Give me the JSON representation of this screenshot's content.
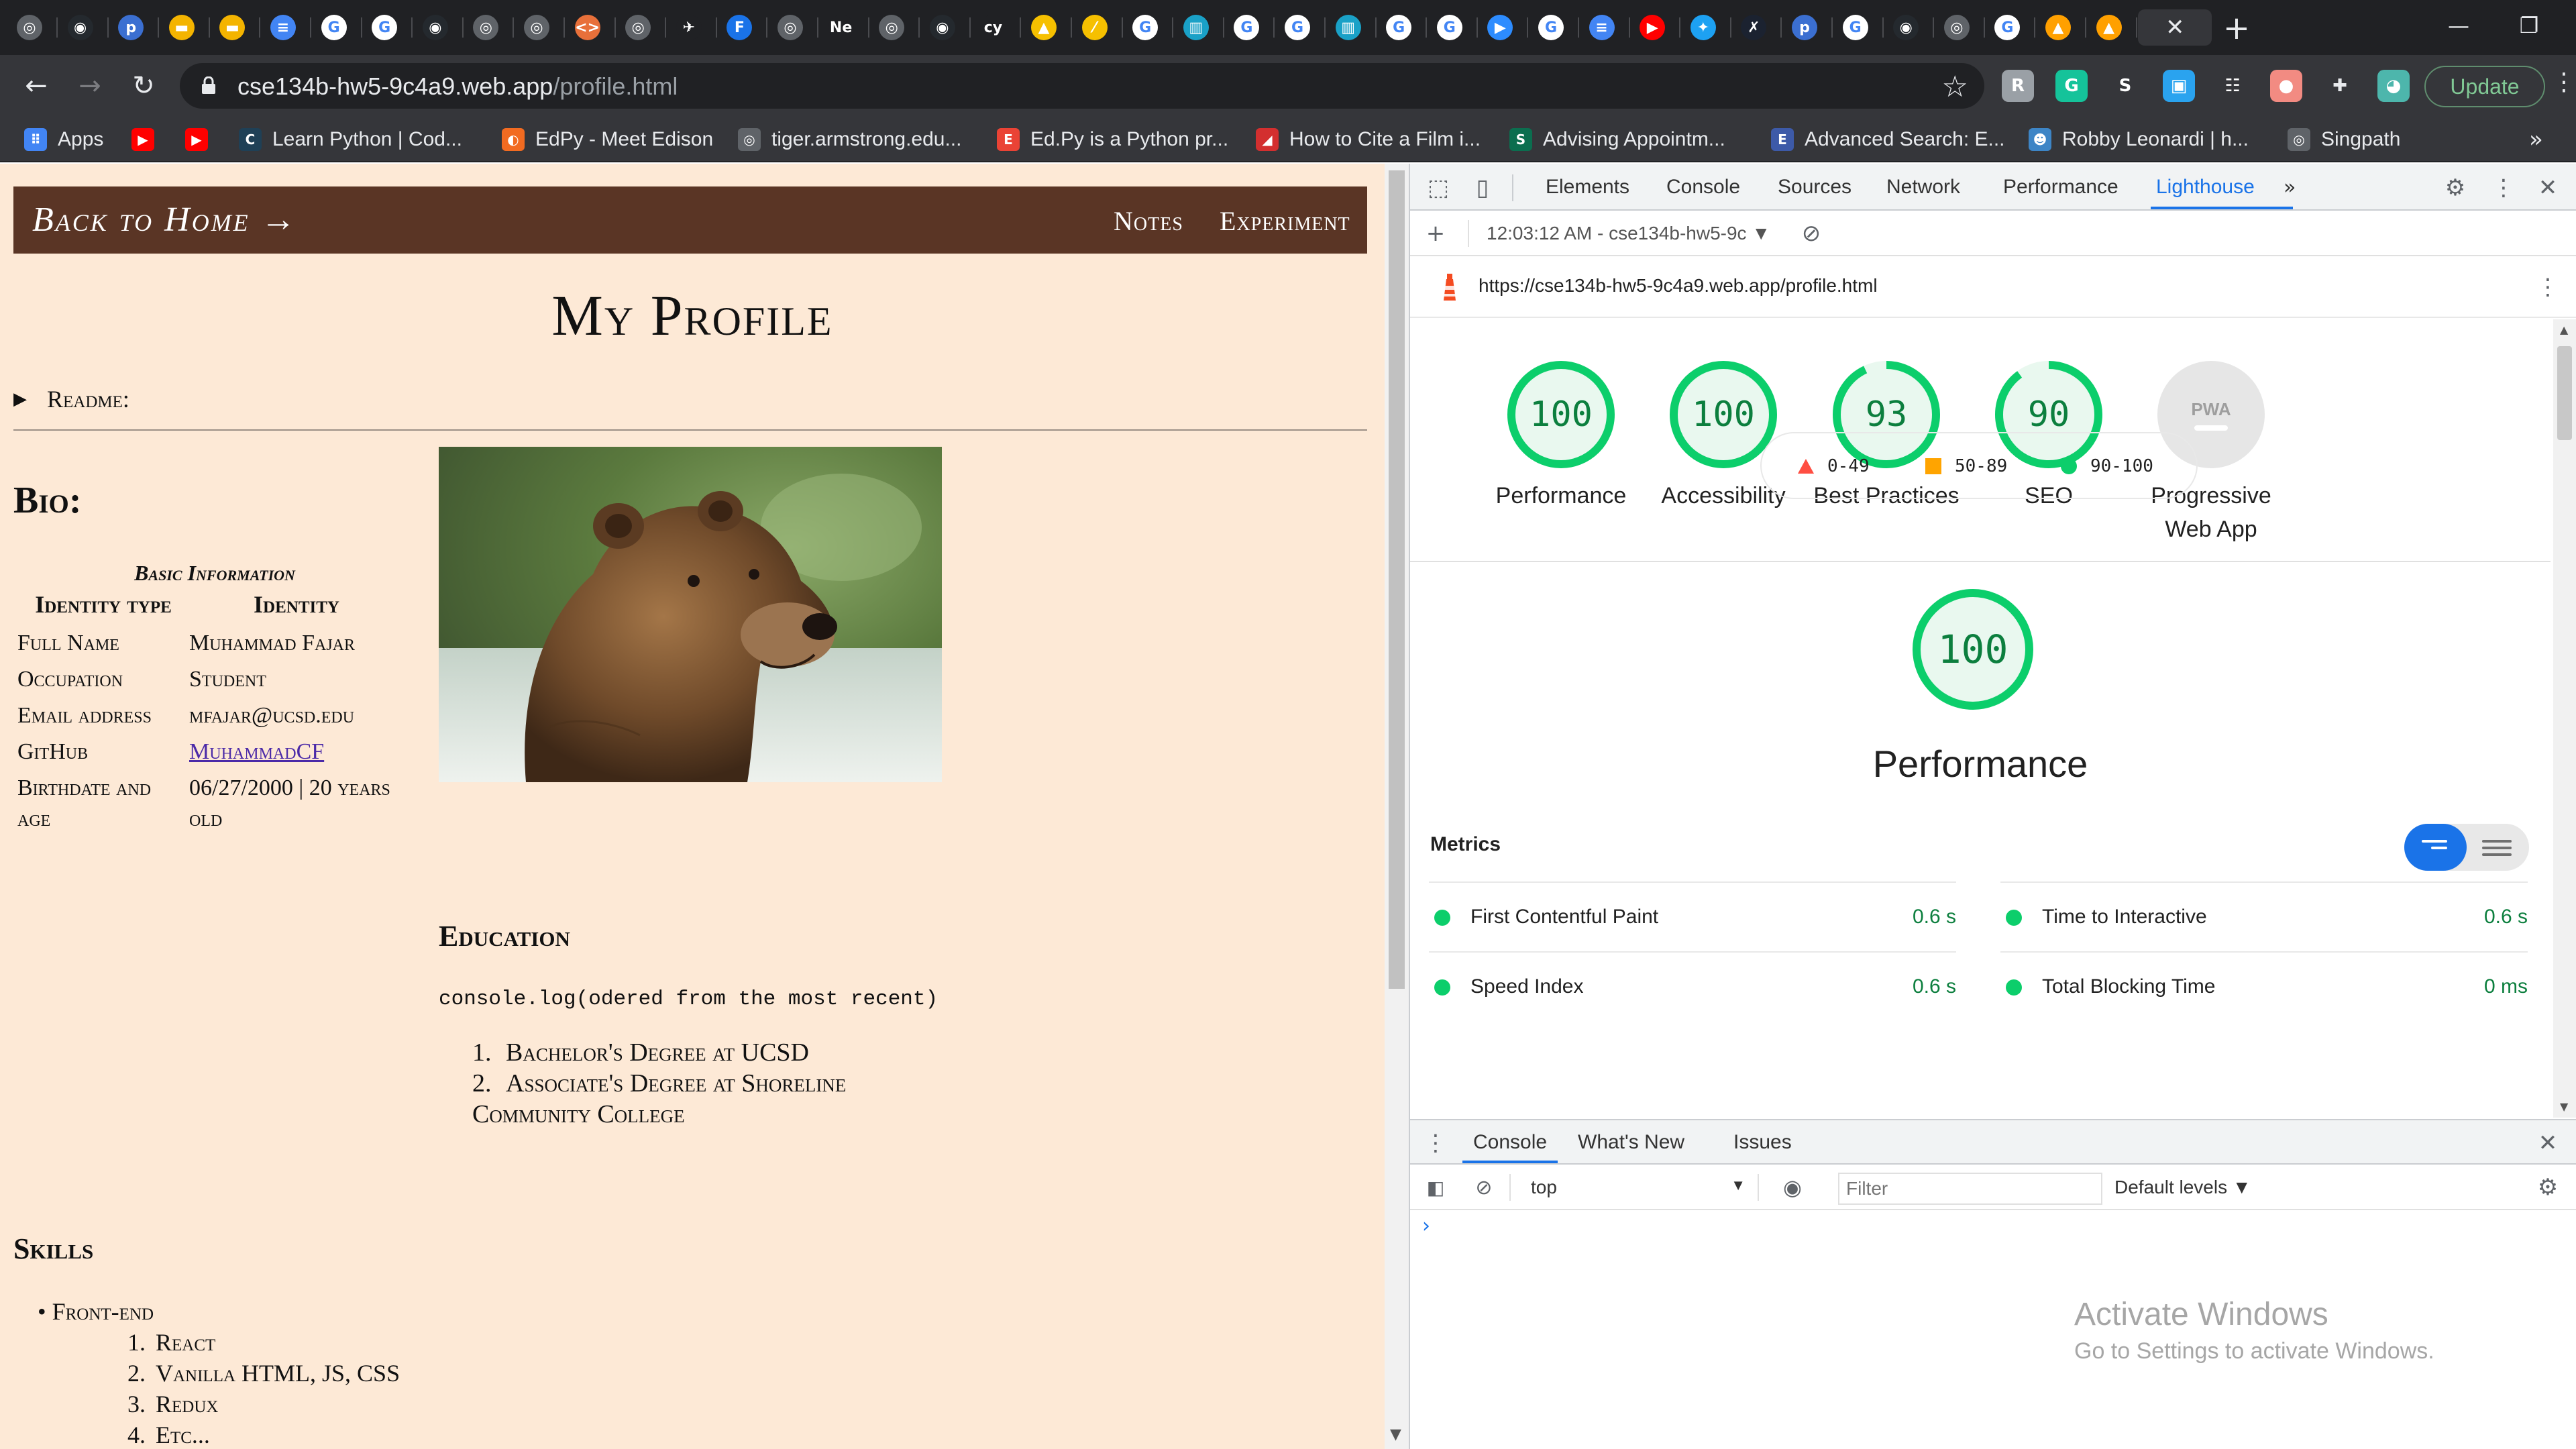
{
  "browser": {
    "tab_favicons": [
      {
        "name": "chrome-globe-icon",
        "color": "#5f6368",
        "glyph": "◎"
      },
      {
        "name": "github-icon",
        "color": "#24292e",
        "glyph": "◉"
      },
      {
        "name": "p-icon",
        "color": "#3b6fd1",
        "glyph": "p"
      },
      {
        "name": "slides-icon",
        "color": "#f4b400",
        "glyph": "▬"
      },
      {
        "name": "slides-icon",
        "color": "#f4b400",
        "glyph": "▬"
      },
      {
        "name": "docs-icon",
        "color": "#4285f4",
        "glyph": "≡"
      },
      {
        "name": "google-icon",
        "color": "#ffffff",
        "glyph": "G"
      },
      {
        "name": "google-icon",
        "color": "#ffffff",
        "glyph": "G"
      },
      {
        "name": "github-icon",
        "color": "#24292e",
        "glyph": "◉"
      },
      {
        "name": "chrome-globe-icon",
        "color": "#5f6368",
        "glyph": "◎"
      },
      {
        "name": "chrome-globe-icon",
        "color": "#5f6368",
        "glyph": "◎"
      },
      {
        "name": "code-icon",
        "color": "#e8703a",
        "glyph": "<>"
      },
      {
        "name": "chrome-globe-icon",
        "color": "#5f6368",
        "glyph": "◎"
      },
      {
        "name": "plane-icon",
        "color": "#202124",
        "glyph": "✈"
      },
      {
        "name": "f-icon",
        "color": "#1a73e8",
        "glyph": "F"
      },
      {
        "name": "chrome-globe-icon",
        "color": "#5f6368",
        "glyph": "◎"
      },
      {
        "name": "ne-icon",
        "color": "#202124",
        "glyph": "Ne"
      },
      {
        "name": "chrome-globe-icon",
        "color": "#5f6368",
        "glyph": "◎"
      },
      {
        "name": "github-icon",
        "color": "#24292e",
        "glyph": "◉"
      },
      {
        "name": "cy-icon",
        "color": "#202124",
        "glyph": "cy"
      },
      {
        "name": "image-icon",
        "color": "#f6c000",
        "glyph": "▲"
      },
      {
        "name": "slash-icon",
        "color": "#f6c000",
        "glyph": "⁄"
      },
      {
        "name": "google-icon",
        "color": "#ffffff",
        "glyph": "G"
      },
      {
        "name": "analytics-icon",
        "color": "#1aa1c7",
        "glyph": "▥"
      },
      {
        "name": "google-icon",
        "color": "#ffffff",
        "glyph": "G"
      },
      {
        "name": "google-icon",
        "color": "#ffffff",
        "glyph": "G"
      },
      {
        "name": "analytics-icon",
        "color": "#1aa1c7",
        "glyph": "▥"
      },
      {
        "name": "google-icon",
        "color": "#ffffff",
        "glyph": "G"
      },
      {
        "name": "google-icon",
        "color": "#ffffff",
        "glyph": "G"
      },
      {
        "name": "zoom-icon",
        "color": "#2d8cff",
        "glyph": "▶"
      },
      {
        "name": "google-icon",
        "color": "#ffffff",
        "glyph": "G"
      },
      {
        "name": "docs-icon",
        "color": "#4285f4",
        "glyph": "≡"
      },
      {
        "name": "youtube-icon",
        "color": "#ff0000",
        "glyph": "▶"
      },
      {
        "name": "twitter-icon",
        "color": "#1da1f2",
        "glyph": "✦"
      },
      {
        "name": "x-icon",
        "color": "#1b2230",
        "glyph": "✗"
      },
      {
        "name": "p-icon",
        "color": "#3b6fd1",
        "glyph": "p"
      },
      {
        "name": "google-icon",
        "color": "#ffffff",
        "glyph": "G"
      },
      {
        "name": "github-icon",
        "color": "#24292e",
        "glyph": "◉"
      },
      {
        "name": "chrome-globe-icon",
        "color": "#5f6368",
        "glyph": "◎"
      },
      {
        "name": "google-icon",
        "color": "#ffffff",
        "glyph": "G"
      },
      {
        "name": "firebase-icon",
        "color": "#ffa000",
        "glyph": "▲"
      },
      {
        "name": "firebase-icon",
        "color": "#ffa000",
        "glyph": "▲"
      }
    ],
    "active_tab_close": "✕",
    "new_tab": "+",
    "window_controls": {
      "minimize": "—",
      "restore": "❐",
      "close": "✕"
    },
    "nav": {
      "back": "←",
      "forward": "→",
      "reload": "↻"
    },
    "address": {
      "host": "cse134b-hw5-9c4a9.web.app",
      "path": "/profile.html"
    },
    "star": "☆",
    "extensions": [
      {
        "name": "extension-gray-icon",
        "color": "#9aa0a6",
        "glyph": "R"
      },
      {
        "name": "grammarly-icon",
        "color": "#15c39a",
        "glyph": "G"
      },
      {
        "name": "s-extension-icon",
        "color": "#ffffff",
        "glyph": "S"
      },
      {
        "name": "window-extension-icon",
        "color": "#2aa3ef",
        "glyph": "▣"
      },
      {
        "name": "grid-extension-icon",
        "color": "#ffffff",
        "glyph": "☷"
      },
      {
        "name": "bulb-extension-icon",
        "color": "#f28b82",
        "glyph": "●"
      },
      {
        "name": "puzzle-extensions-icon",
        "color": "#e8eaed",
        "glyph": "✚"
      },
      {
        "name": "profile-avatar-icon",
        "color": "#4db6ac",
        "glyph": "◕"
      }
    ],
    "update_label": "Update",
    "menu": "⋮",
    "bookmarks": [
      {
        "label": "Apps",
        "icon": "apps-grid-icon",
        "color": "#4285f4",
        "glyph": "⠿"
      },
      {
        "label": "",
        "icon": "youtube-icon",
        "color": "#ff0000",
        "glyph": "▶"
      },
      {
        "label": "",
        "icon": "youtube-icon",
        "color": "#ff0000",
        "glyph": "▶"
      },
      {
        "label": "Learn Python | Cod...",
        "icon": "codecademy-icon",
        "color": "#1f4056",
        "glyph": "C"
      },
      {
        "label": "EdPy - Meet Edison",
        "icon": "edpy-icon",
        "color": "#f26b21",
        "glyph": "◐"
      },
      {
        "label": "tiger.armstrong.edu...",
        "icon": "globe-icon",
        "color": "#5f6368",
        "glyph": "◎"
      },
      {
        "label": "Ed.Py is a Python pr...",
        "icon": "edpy-doc-icon",
        "color": "#ea4335",
        "glyph": "E"
      },
      {
        "label": "How to Cite a Film i...",
        "icon": "doc-red-icon",
        "color": "#d32f2f",
        "glyph": "◢"
      },
      {
        "label": "Advising Appointm...",
        "icon": "scc-icon",
        "color": "#0b6e4f",
        "glyph": "S"
      },
      {
        "label": "Advanced Search: E...",
        "icon": "ebsco-icon",
        "color": "#3d5aa8",
        "glyph": "E"
      },
      {
        "label": "Robby Leonardi | h...",
        "icon": "robby-icon",
        "color": "#3d85c6",
        "glyph": "☻"
      },
      {
        "label": "Singpath",
        "icon": "globe-icon",
        "color": "#5f6368",
        "glyph": "◎"
      }
    ],
    "bookmarks_more": "»"
  },
  "page": {
    "nav": {
      "back_home": "Back to Home →",
      "notes": "Notes",
      "experiment": "Experiment"
    },
    "title": "My Profile",
    "readme": "Readme:",
    "bio": {
      "title": "Bio:",
      "caption": "Basic Information",
      "headers": [
        "Identity type",
        "Identity"
      ],
      "rows": [
        {
          "key": "Full Name",
          "value": "Muhammad Fajar",
          "link": false
        },
        {
          "key": "Occupation",
          "value": "Student",
          "link": false
        },
        {
          "key": "Email address",
          "value": "mfajar@ucsd.edu",
          "link": false
        },
        {
          "key": "GitHub",
          "value": "MuhammadCF",
          "link": true
        },
        {
          "key": "Birthdate and age",
          "value": "06/27/2000 | 20 years old",
          "link": false
        }
      ]
    },
    "education": {
      "title": "Education",
      "code": "console.log(odered from the most recent)",
      "items": [
        "Bachelor's Degree at UCSD",
        "Associate's Degree at Shoreline Community College"
      ]
    },
    "skills": {
      "title": "Skills",
      "group": "Front-end",
      "items": [
        "React",
        "Vanilla HTML, JS, CSS",
        "Redux",
        "Etc..."
      ]
    },
    "bg_color": "#fde9d6",
    "nav_color": "#5a3525"
  },
  "devtools": {
    "tabs": [
      "Elements",
      "Console",
      "Sources",
      "Network",
      "Performance",
      "Lighthouse"
    ],
    "active_tab": "Lighthouse",
    "more_tabs": "»",
    "report_selector": "12:03:12 AM - cse134b-hw5-9c",
    "report_url": "https://cse134b-hw5-9c4a9.web.app/profile.html",
    "scores": [
      {
        "label": "Performance",
        "value": 100,
        "color": "#0cce6b"
      },
      {
        "label": "Accessibility",
        "value": 100,
        "color": "#0cce6b"
      },
      {
        "label": "Best Practices",
        "value": 93,
        "color": "#0cce6b"
      },
      {
        "label": "SEO",
        "value": 90,
        "color": "#0cce6b"
      },
      {
        "label": "Progressive Web App",
        "value": null,
        "badge": "PWA",
        "color": "#bdbdbd"
      }
    ],
    "legend": [
      {
        "range": "0-49",
        "color": "#ff4e42",
        "shape": "triangle"
      },
      {
        "range": "50-89",
        "color": "#ffa400",
        "shape": "square"
      },
      {
        "range": "90-100",
        "color": "#0cce6b",
        "shape": "circle"
      }
    ],
    "performance": {
      "score": 100,
      "title": "Performance"
    },
    "metrics_title": "Metrics",
    "metrics": [
      {
        "name": "First Contentful Paint",
        "value": "0.6 s"
      },
      {
        "name": "Time to Interactive",
        "value": "0.6 s"
      },
      {
        "name": "Speed Index",
        "value": "0.6 s"
      },
      {
        "name": "Total Blocking Time",
        "value": "0 ms"
      }
    ],
    "drawer": {
      "tabs": [
        "Console",
        "What's New",
        "Issues"
      ],
      "context": "top",
      "filter_placeholder": "Filter",
      "levels": "Default levels ▼",
      "prompt": "›"
    }
  },
  "watermark": {
    "title": "Activate Windows",
    "subtitle": "Go to Settings to activate Windows."
  }
}
